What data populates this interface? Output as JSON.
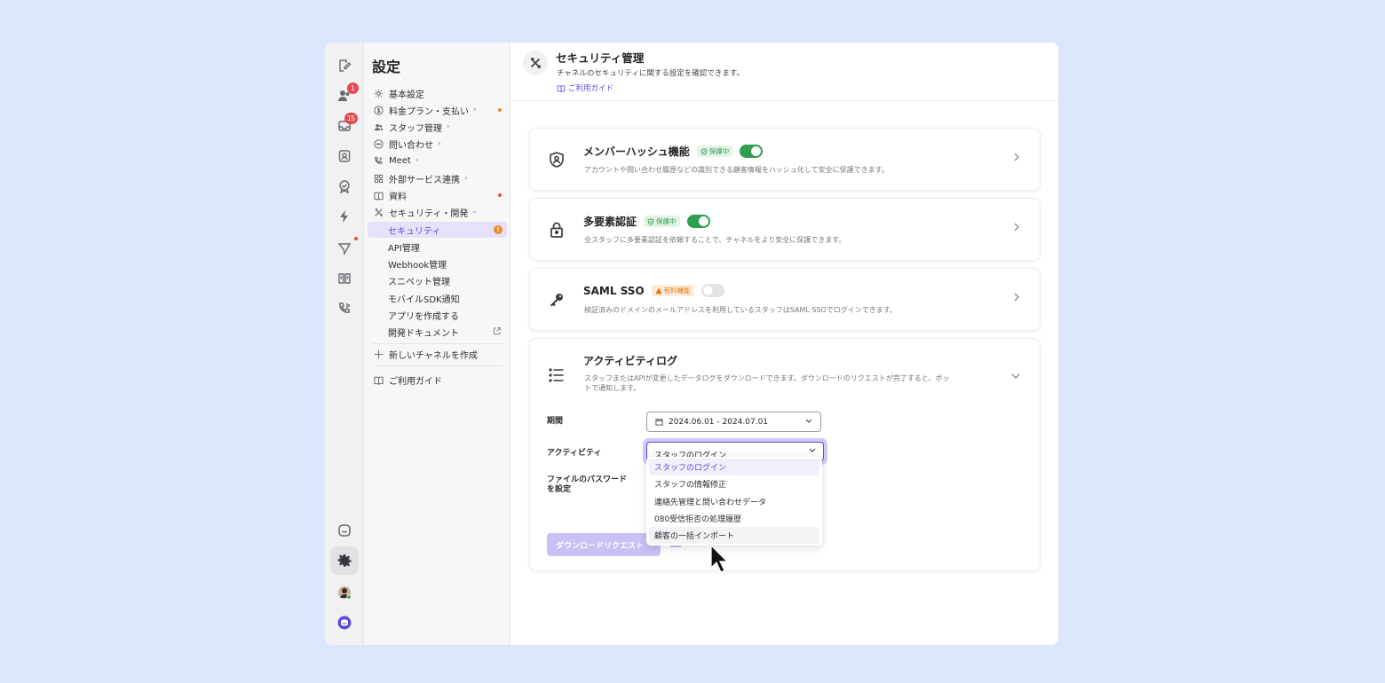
{
  "rail": {
    "badges": {
      "contacts": "1",
      "inbox": "15"
    }
  },
  "sidebar": {
    "title": "設定",
    "items": [
      {
        "label": "基本設定",
        "icon": "gear-icon"
      },
      {
        "label": "料金プラン・支払い",
        "icon": "dollar-icon",
        "dot_color": "#f08a24"
      },
      {
        "label": "スタッフ管理",
        "icon": "staff-icon"
      },
      {
        "label": "問い合わせ",
        "icon": "chat-icon"
      },
      {
        "label": "Meet",
        "icon": "phone-icon"
      },
      {
        "label": "外部サービス連携",
        "icon": "grid-icon"
      },
      {
        "label": "資料",
        "icon": "book-icon",
        "dot_color": "#e5484d"
      },
      {
        "label": "セキュリティ・開発",
        "icon": "tools-icon"
      }
    ],
    "sub_items": [
      {
        "label": "セキュリティ",
        "alert": "!"
      },
      {
        "label": "API管理"
      },
      {
        "label": "Webhook管理"
      },
      {
        "label": "スニペット管理"
      },
      {
        "label": "モバイルSDK通知"
      },
      {
        "label": "アプリを作成する"
      },
      {
        "label": "開発ドキュメント"
      }
    ],
    "new_channel": "新しいチャネルを作成",
    "guide": "ご利用ガイド"
  },
  "header": {
    "title": "セキュリティ管理",
    "description": "チャネルのセキュリティに関する設定を確認できます。",
    "guide_link": "ご利用ガイド"
  },
  "cards": [
    {
      "title": "メンバーハッシュ機能",
      "badge": "保護中",
      "badge_type": "green",
      "toggle": true,
      "description": "アカウントや問い合わせ履歴などの識別できる顧客情報をハッシュ化して安全に保護できます。"
    },
    {
      "title": "多要素認証",
      "badge": "保護中",
      "badge_type": "green",
      "toggle": true,
      "description": "全スタッフに多要素認証を依頼することで、チャネルをより安全に保護できます。"
    },
    {
      "title": "SAML SSO",
      "badge": "有料機能",
      "badge_type": "orange",
      "toggle": false,
      "description": "検証済みのドメインのメールアドレスを利用しているスタッフはSAML SSOでログインできます。"
    }
  ],
  "activity_log": {
    "title": "アクティビティログ",
    "description_line1": "スタッフまたはAPIが変更したデータログをダウンロードできます。ダウンロードのリクエストが完了すると、ボッ",
    "description_line2": "トで通知します。",
    "period_label": "期間",
    "period_value": "2024.06.01 - 2024.07.01",
    "activity_label": "アクティビティ",
    "activity_value": "スタッフのログイン",
    "password_label_line1": "ファイルのパスワード",
    "password_label_line2": "を設定",
    "options": [
      "スタッフのログイン",
      "スタッフの情報修正",
      "連絡先管理と問い合わせデータ",
      "080受信拒否の処理履歴",
      "顧客の一括インポート"
    ],
    "download_button": "ダウンロードリクエスト"
  },
  "colors": {
    "accent": "#5b4bdb",
    "green": "#2f9e4e",
    "orange": "#f08a24",
    "red": "#e5484d",
    "background": "#dbe6fd"
  }
}
